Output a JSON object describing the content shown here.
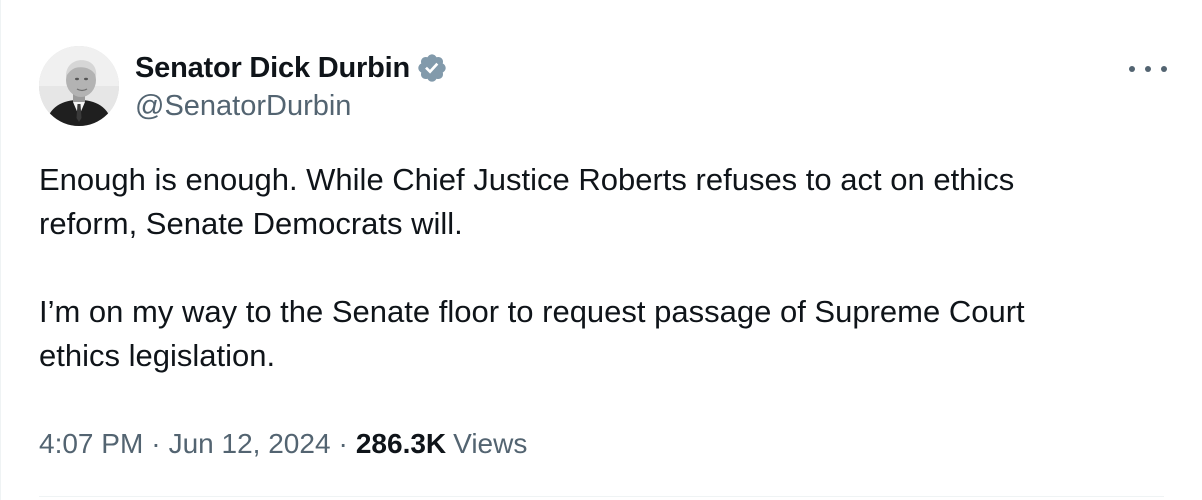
{
  "author": {
    "display_name": "Senator Dick Durbin",
    "handle": "@SenatorDurbin",
    "verified_icon": "verified-badge-icon",
    "verified_color": "#829aab"
  },
  "tweet": {
    "paragraphs": [
      "Enough is enough. While Chief Justice Roberts refuses to act on ethics\nreform, Senate Democrats will.",
      "I’m on my way to the Senate floor to request passage of Supreme Court\nethics legislation."
    ]
  },
  "meta": {
    "time": "4:07 PM",
    "separator": "·",
    "date": "Jun 12, 2024",
    "views_count": "286.3K",
    "views_label": "Views"
  },
  "menu": {
    "icon": "more-options-icon"
  },
  "colors": {
    "text_primary": "#0f1419",
    "text_secondary": "#536471",
    "divider": "#eff3f4"
  }
}
